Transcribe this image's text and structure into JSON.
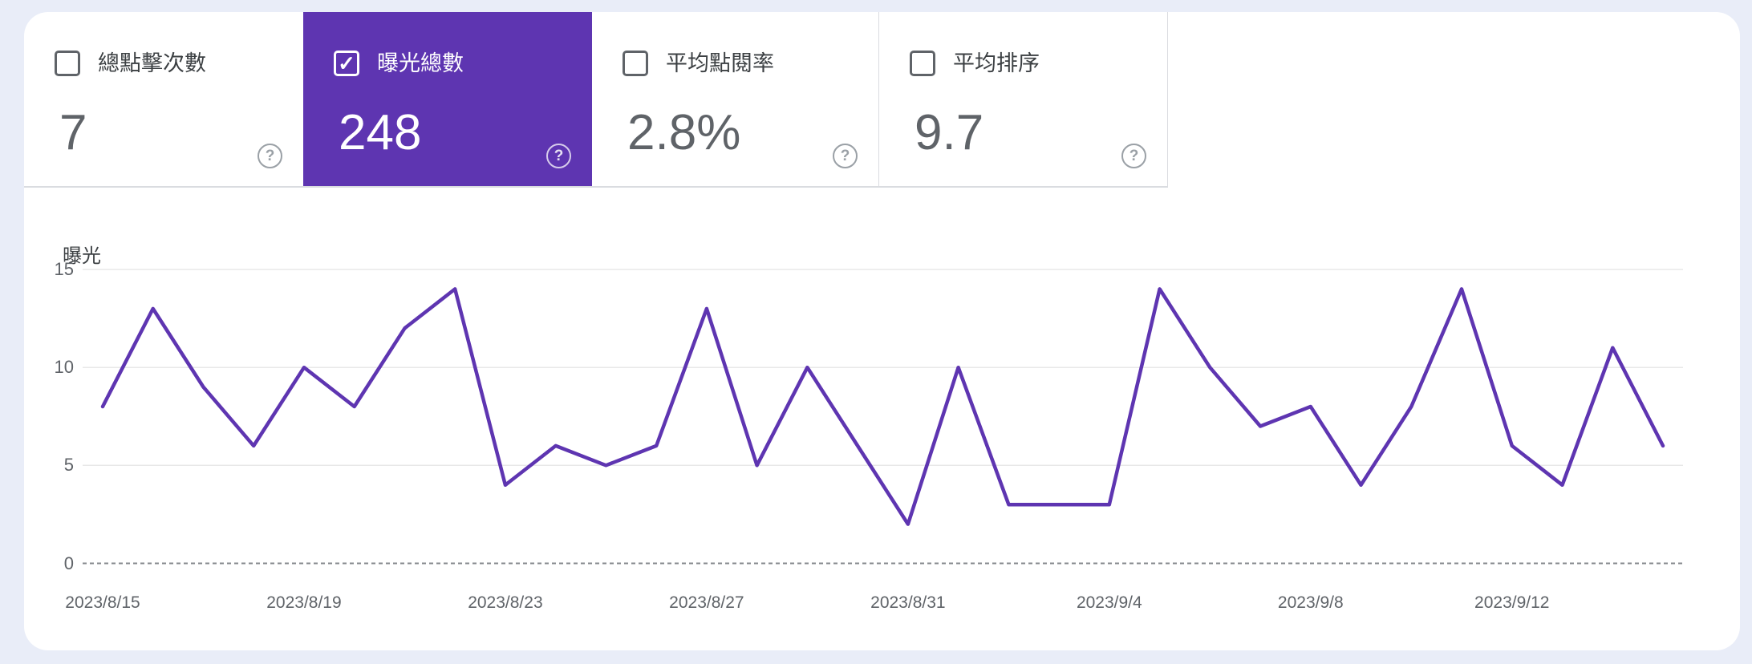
{
  "cards": [
    {
      "label": "總點擊次數",
      "value": "7",
      "checked": false
    },
    {
      "label": "曝光總數",
      "value": "248",
      "checked": true
    },
    {
      "label": "平均點閱率",
      "value": "2.8%",
      "checked": false
    },
    {
      "label": "平均排序",
      "value": "9.7",
      "checked": false
    }
  ],
  "help_glyph": "?",
  "check_glyph": "✓",
  "chart_data": {
    "type": "line",
    "title": "曝光",
    "x": [
      "2023/8/15",
      "2023/8/16",
      "2023/8/17",
      "2023/8/18",
      "2023/8/19",
      "2023/8/20",
      "2023/8/21",
      "2023/8/22",
      "2023/8/23",
      "2023/8/24",
      "2023/8/25",
      "2023/8/26",
      "2023/8/27",
      "2023/8/28",
      "2023/8/29",
      "2023/8/30",
      "2023/8/31",
      "2023/9/1",
      "2023/9/2",
      "2023/9/3",
      "2023/9/4",
      "2023/9/5",
      "2023/9/6",
      "2023/9/7",
      "2023/9/8",
      "2023/9/9",
      "2023/9/10",
      "2023/9/11",
      "2023/9/12",
      "2023/9/13",
      "2023/9/14",
      "2023/9/15"
    ],
    "series": [
      {
        "name": "曝光",
        "values": [
          8,
          13,
          9,
          6,
          10,
          8,
          12,
          14,
          4,
          6,
          5,
          6,
          13,
          5,
          10,
          6,
          2,
          10,
          3,
          3,
          3,
          14,
          10,
          7,
          8,
          4,
          8,
          14,
          6,
          4,
          11,
          6
        ]
      }
    ],
    "total": 248,
    "ylim": [
      0,
      15
    ],
    "yticks": [
      15,
      10,
      5,
      0
    ],
    "xtick_labels": [
      {
        "index": 0,
        "label": "2023/8/15"
      },
      {
        "index": 4,
        "label": "2023/8/19"
      },
      {
        "index": 8,
        "label": "2023/8/23"
      },
      {
        "index": 12,
        "label": "2023/8/27"
      },
      {
        "index": 16,
        "label": "2023/8/31"
      },
      {
        "index": 20,
        "label": "2023/9/4"
      },
      {
        "index": 24,
        "label": "2023/9/8"
      },
      {
        "index": 28,
        "label": "2023/9/12"
      }
    ],
    "grid": "horizontal",
    "legend": "none",
    "line_color": "#5e35b1"
  }
}
